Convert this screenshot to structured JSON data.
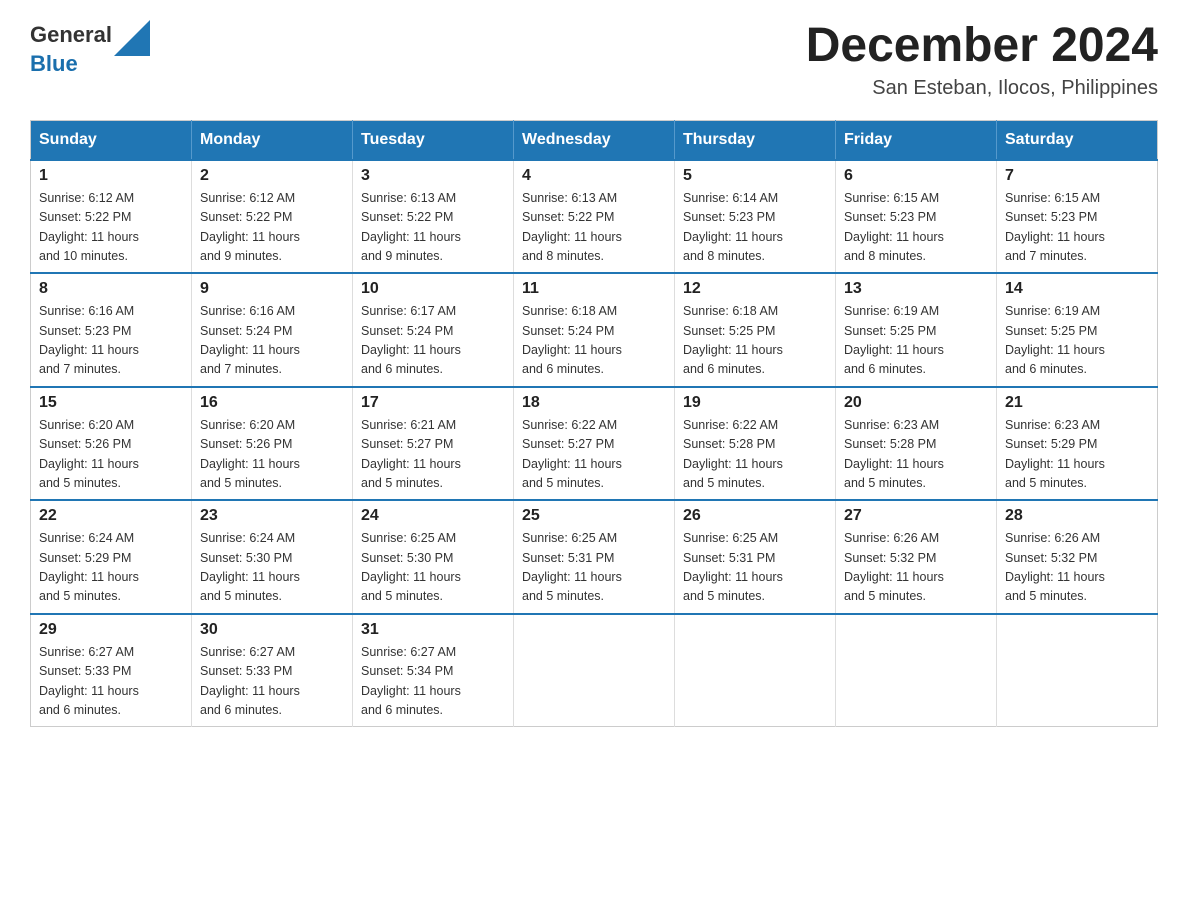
{
  "header": {
    "logo_general": "General",
    "logo_blue": "Blue",
    "month_title": "December 2024",
    "location": "San Esteban, Ilocos, Philippines"
  },
  "days_of_week": [
    "Sunday",
    "Monday",
    "Tuesday",
    "Wednesday",
    "Thursday",
    "Friday",
    "Saturday"
  ],
  "weeks": [
    [
      {
        "day": "1",
        "sunrise": "6:12 AM",
        "sunset": "5:22 PM",
        "daylight": "11 hours and 10 minutes."
      },
      {
        "day": "2",
        "sunrise": "6:12 AM",
        "sunset": "5:22 PM",
        "daylight": "11 hours and 9 minutes."
      },
      {
        "day": "3",
        "sunrise": "6:13 AM",
        "sunset": "5:22 PM",
        "daylight": "11 hours and 9 minutes."
      },
      {
        "day": "4",
        "sunrise": "6:13 AM",
        "sunset": "5:22 PM",
        "daylight": "11 hours and 8 minutes."
      },
      {
        "day": "5",
        "sunrise": "6:14 AM",
        "sunset": "5:23 PM",
        "daylight": "11 hours and 8 minutes."
      },
      {
        "day": "6",
        "sunrise": "6:15 AM",
        "sunset": "5:23 PM",
        "daylight": "11 hours and 8 minutes."
      },
      {
        "day": "7",
        "sunrise": "6:15 AM",
        "sunset": "5:23 PM",
        "daylight": "11 hours and 7 minutes."
      }
    ],
    [
      {
        "day": "8",
        "sunrise": "6:16 AM",
        "sunset": "5:23 PM",
        "daylight": "11 hours and 7 minutes."
      },
      {
        "day": "9",
        "sunrise": "6:16 AM",
        "sunset": "5:24 PM",
        "daylight": "11 hours and 7 minutes."
      },
      {
        "day": "10",
        "sunrise": "6:17 AM",
        "sunset": "5:24 PM",
        "daylight": "11 hours and 6 minutes."
      },
      {
        "day": "11",
        "sunrise": "6:18 AM",
        "sunset": "5:24 PM",
        "daylight": "11 hours and 6 minutes."
      },
      {
        "day": "12",
        "sunrise": "6:18 AM",
        "sunset": "5:25 PM",
        "daylight": "11 hours and 6 minutes."
      },
      {
        "day": "13",
        "sunrise": "6:19 AM",
        "sunset": "5:25 PM",
        "daylight": "11 hours and 6 minutes."
      },
      {
        "day": "14",
        "sunrise": "6:19 AM",
        "sunset": "5:25 PM",
        "daylight": "11 hours and 6 minutes."
      }
    ],
    [
      {
        "day": "15",
        "sunrise": "6:20 AM",
        "sunset": "5:26 PM",
        "daylight": "11 hours and 5 minutes."
      },
      {
        "day": "16",
        "sunrise": "6:20 AM",
        "sunset": "5:26 PM",
        "daylight": "11 hours and 5 minutes."
      },
      {
        "day": "17",
        "sunrise": "6:21 AM",
        "sunset": "5:27 PM",
        "daylight": "11 hours and 5 minutes."
      },
      {
        "day": "18",
        "sunrise": "6:22 AM",
        "sunset": "5:27 PM",
        "daylight": "11 hours and 5 minutes."
      },
      {
        "day": "19",
        "sunrise": "6:22 AM",
        "sunset": "5:28 PM",
        "daylight": "11 hours and 5 minutes."
      },
      {
        "day": "20",
        "sunrise": "6:23 AM",
        "sunset": "5:28 PM",
        "daylight": "11 hours and 5 minutes."
      },
      {
        "day": "21",
        "sunrise": "6:23 AM",
        "sunset": "5:29 PM",
        "daylight": "11 hours and 5 minutes."
      }
    ],
    [
      {
        "day": "22",
        "sunrise": "6:24 AM",
        "sunset": "5:29 PM",
        "daylight": "11 hours and 5 minutes."
      },
      {
        "day": "23",
        "sunrise": "6:24 AM",
        "sunset": "5:30 PM",
        "daylight": "11 hours and 5 minutes."
      },
      {
        "day": "24",
        "sunrise": "6:25 AM",
        "sunset": "5:30 PM",
        "daylight": "11 hours and 5 minutes."
      },
      {
        "day": "25",
        "sunrise": "6:25 AM",
        "sunset": "5:31 PM",
        "daylight": "11 hours and 5 minutes."
      },
      {
        "day": "26",
        "sunrise": "6:25 AM",
        "sunset": "5:31 PM",
        "daylight": "11 hours and 5 minutes."
      },
      {
        "day": "27",
        "sunrise": "6:26 AM",
        "sunset": "5:32 PM",
        "daylight": "11 hours and 5 minutes."
      },
      {
        "day": "28",
        "sunrise": "6:26 AM",
        "sunset": "5:32 PM",
        "daylight": "11 hours and 5 minutes."
      }
    ],
    [
      {
        "day": "29",
        "sunrise": "6:27 AM",
        "sunset": "5:33 PM",
        "daylight": "11 hours and 6 minutes."
      },
      {
        "day": "30",
        "sunrise": "6:27 AM",
        "sunset": "5:33 PM",
        "daylight": "11 hours and 6 minutes."
      },
      {
        "day": "31",
        "sunrise": "6:27 AM",
        "sunset": "5:34 PM",
        "daylight": "11 hours and 6 minutes."
      },
      null,
      null,
      null,
      null
    ]
  ],
  "labels": {
    "sunrise": "Sunrise:",
    "sunset": "Sunset:",
    "daylight": "Daylight:"
  }
}
